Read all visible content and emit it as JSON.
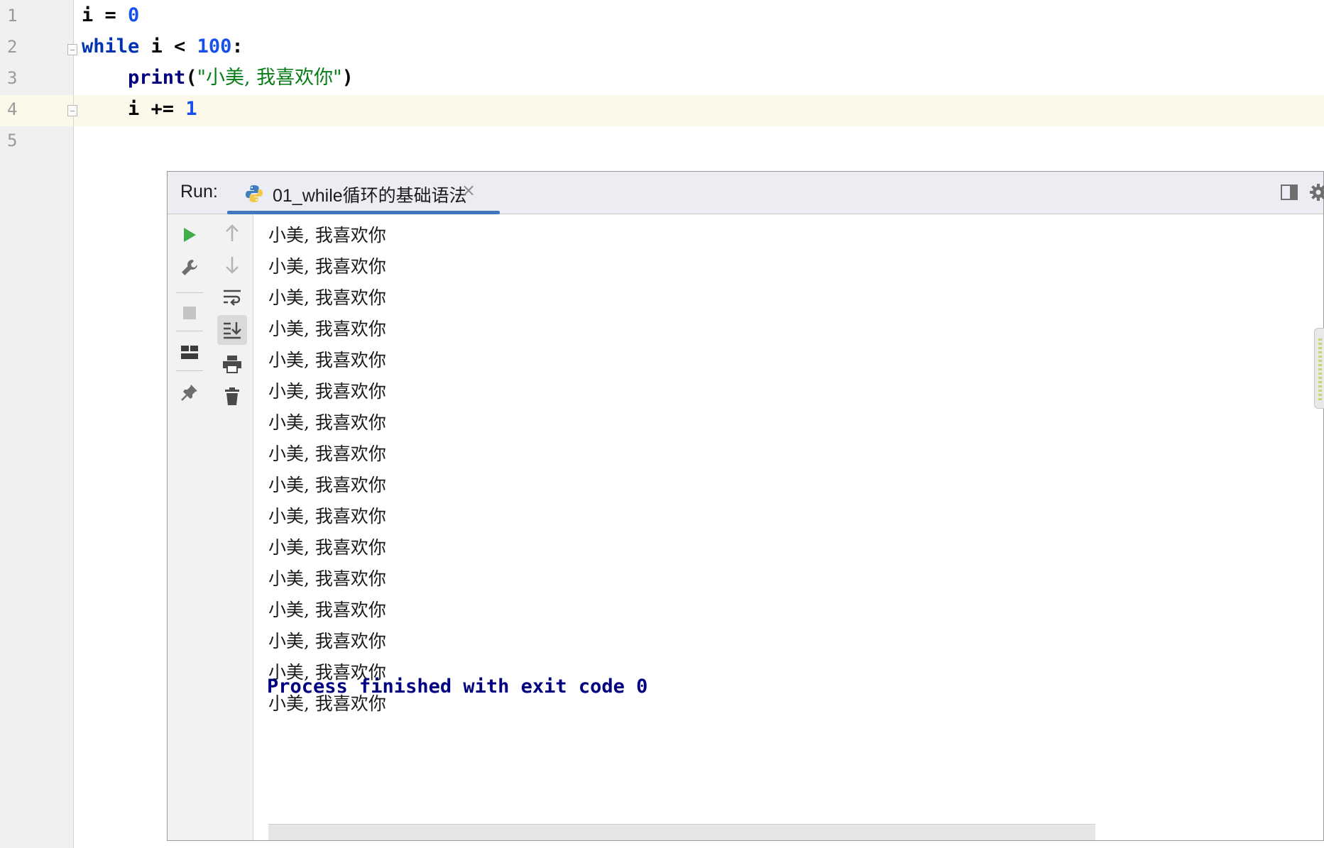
{
  "editor": {
    "line_numbers": [
      "1",
      "2",
      "3",
      "4",
      "5"
    ],
    "lines": [
      {
        "parts": [
          {
            "t": "i = ",
            "c": "plain"
          },
          {
            "t": "0",
            "c": "num"
          }
        ]
      },
      {
        "parts": [
          {
            "t": "while",
            "c": "kw"
          },
          {
            "t": " i < ",
            "c": "plain"
          },
          {
            "t": "100",
            "c": "num"
          },
          {
            "t": ":",
            "c": "plain"
          }
        ]
      },
      {
        "parts": [
          {
            "t": "    ",
            "c": "plain"
          },
          {
            "t": "print",
            "c": "fn"
          },
          {
            "t": "(",
            "c": "plain"
          },
          {
            "t": "\"小美, 我喜欢你\"",
            "c": "str"
          },
          {
            "t": ")",
            "c": "plain"
          }
        ]
      },
      {
        "parts": [
          {
            "t": "    i += ",
            "c": "plain"
          },
          {
            "t": "1",
            "c": "num"
          }
        ]
      },
      {
        "parts": []
      }
    ],
    "current_line": 4
  },
  "run": {
    "label": "Run:",
    "tab_title": "01_while循环的基础语法",
    "tab_close": "×",
    "icons_left": [
      "run-icon",
      "wrench-icon",
      "stop-icon",
      "layout-icon",
      "pin-icon"
    ],
    "icons_right": [
      "arrow-up-icon",
      "arrow-down-icon",
      "soft-wrap-icon",
      "scroll-to-end-icon",
      "print-icon",
      "trash-icon"
    ],
    "output_lines": [
      "小美, 我喜欢你",
      "小美, 我喜欢你",
      "小美, 我喜欢你",
      "小美, 我喜欢你",
      "小美, 我喜欢你",
      "小美, 我喜欢你",
      "小美, 我喜欢你",
      "小美, 我喜欢你",
      "小美, 我喜欢你",
      "小美, 我喜欢你",
      "小美, 我喜欢你",
      "小美, 我喜欢你",
      "小美, 我喜欢你",
      "小美, 我喜欢你",
      "小美, 我喜欢你",
      "小美, 我喜欢你"
    ],
    "process_message": "Process finished with exit code 0"
  },
  "colors": {
    "accent": "#4078c0",
    "run_green": "#3fae48",
    "process_text": "#000080",
    "current_line": "#fcf9ea"
  }
}
